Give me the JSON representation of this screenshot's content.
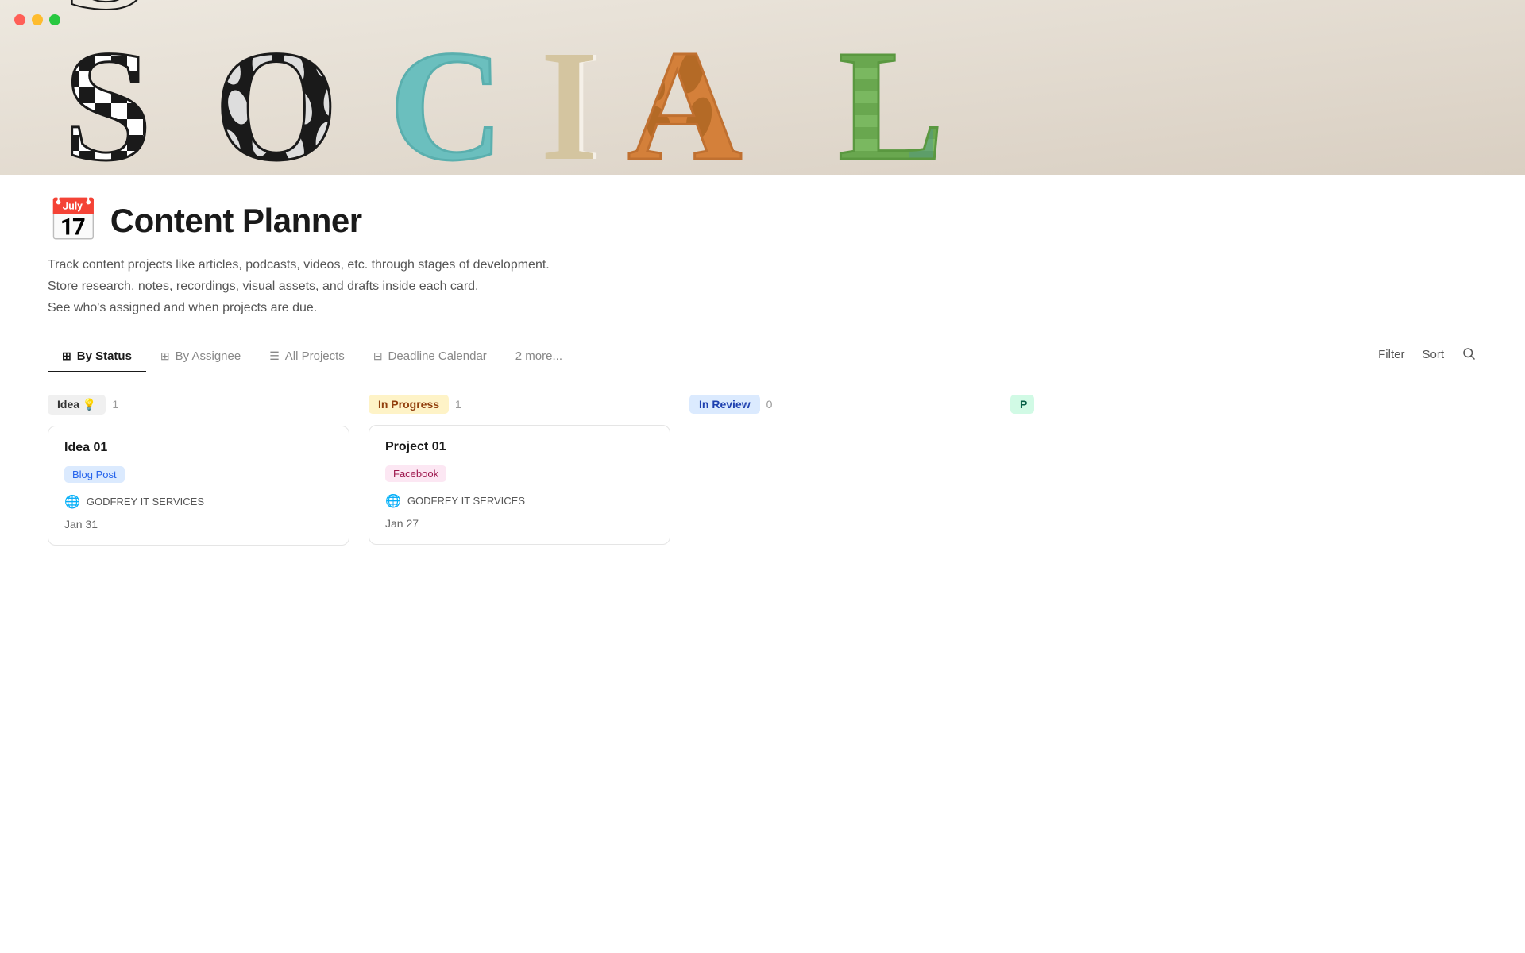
{
  "window": {
    "title": "Content Planner"
  },
  "traffic_lights": {
    "red": "close",
    "yellow": "minimize",
    "green": "maximize"
  },
  "header": {
    "icon": "📅",
    "title": "Content Planner",
    "description_lines": [
      "Track content projects like articles, podcasts, videos, etc. through stages of development.",
      "Store research, notes, recordings, visual assets, and drafts inside each card.",
      "See who's assigned and when projects are due."
    ]
  },
  "tabs": {
    "items": [
      {
        "id": "by-status",
        "label": "By Status",
        "icon": "⊞",
        "active": true
      },
      {
        "id": "by-assignee",
        "label": "By Assignee",
        "icon": "⊞",
        "active": false
      },
      {
        "id": "all-projects",
        "label": "All Projects",
        "icon": "☰",
        "active": false
      },
      {
        "id": "deadline-calendar",
        "label": "Deadline Calendar",
        "icon": "⊟",
        "active": false
      },
      {
        "id": "more",
        "label": "2 more...",
        "icon": "",
        "active": false
      }
    ],
    "actions": [
      {
        "id": "filter",
        "label": "Filter"
      },
      {
        "id": "sort",
        "label": "Sort"
      },
      {
        "id": "search",
        "label": "🔍"
      }
    ]
  },
  "kanban": {
    "columns": [
      {
        "id": "idea",
        "status_label": "Idea 💡",
        "badge_class": "badge-idea",
        "count": 1,
        "cards": [
          {
            "title": "Idea 01",
            "tag": "Blog Post",
            "tag_class": "tag-blogpost",
            "assignee": "GODFREY IT SERVICES",
            "date": "Jan 31"
          }
        ]
      },
      {
        "id": "in-progress",
        "status_label": "In Progress",
        "badge_class": "badge-inprogress",
        "count": 1,
        "cards": [
          {
            "title": "Project 01",
            "tag": "Facebook",
            "tag_class": "tag-facebook",
            "assignee": "GODFREY IT SERVICES",
            "date": "Jan 27"
          }
        ]
      },
      {
        "id": "in-review",
        "status_label": "In Review",
        "badge_class": "badge-inreview",
        "count": 0,
        "cards": []
      },
      {
        "id": "published",
        "status_label": "P",
        "badge_class": "badge-published",
        "count": null,
        "cards": [],
        "partial": true
      }
    ]
  },
  "colors": {
    "accent": "#1a1a1a",
    "border": "#e0e0e0"
  }
}
